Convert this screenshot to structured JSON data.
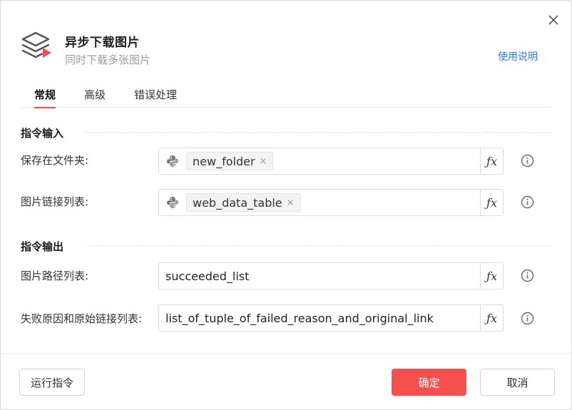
{
  "header": {
    "title": "异步下载图片",
    "subtitle": "同时下载多张图片",
    "help_link": "使用说明",
    "icon": "layers-download-icon"
  },
  "tabs": [
    {
      "label": "常规",
      "active": true
    },
    {
      "label": "高级",
      "active": false
    },
    {
      "label": "错误处理",
      "active": false
    }
  ],
  "input_section": {
    "title": "指令输入",
    "fields": [
      {
        "label": "保存在文件夹:",
        "type": "python-variable",
        "tag": "new_folder"
      },
      {
        "label": "图片链接列表:",
        "type": "python-variable",
        "tag": "web_data_table"
      }
    ]
  },
  "output_section": {
    "title": "指令输出",
    "fields": [
      {
        "label": "图片路径列表:",
        "value": "succeeded_list"
      },
      {
        "label": "失败原因和原始链接列表:",
        "value": "list_of_tuple_of_failed_reason_and_original_link"
      }
    ]
  },
  "fx_label": "ƒx",
  "tag_close": "×",
  "footer": {
    "run_label": "运行指令",
    "ok_label": "确定",
    "cancel_label": "取消"
  },
  "colors": {
    "accent": "#f45050",
    "link": "#2a7be8"
  }
}
